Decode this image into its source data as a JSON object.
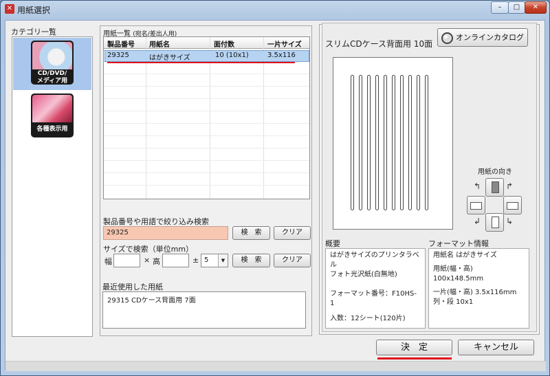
{
  "window": {
    "title": "用紙選択",
    "min": "–",
    "max": "□",
    "close": "✕",
    "accent": "#e0101a"
  },
  "category": {
    "label": "カテゴリ一覧",
    "items": [
      {
        "caption": "CD/DVD/\nメディア用",
        "selected": true
      },
      {
        "caption": "各種表示用",
        "selected": false
      }
    ]
  },
  "paper_list": {
    "title": "用紙一覧",
    "sub": "(宛名/差出人用)",
    "columns": [
      "製品番号",
      "用紙名",
      "面付数",
      "一片サイズ"
    ],
    "rows": [
      [
        "29325",
        "はがきサイズ",
        "10 (10x1)",
        "3.5x116"
      ]
    ]
  },
  "search": {
    "title": "製品番号や用語で絞り込み検索",
    "value": "29325",
    "search_label": "検　索",
    "clear_label": "クリア"
  },
  "size_search": {
    "title": "サイズで検索（単位mm）",
    "width_label": "幅",
    "times": "×",
    "height_label": "高",
    "plusminus": "±",
    "tolerance": "5",
    "search_label": "検　索",
    "clear_label": "クリア"
  },
  "recent": {
    "title": "最近使用した用紙",
    "items": [
      "29315 CDケース背面用 7面"
    ]
  },
  "preview": {
    "title": "スリムCDケース背面用 10面",
    "online_label": "オンラインカタログ",
    "slots": 10
  },
  "orientation": {
    "title": "用紙の向き"
  },
  "summary": {
    "title": "概要",
    "line1": "はがきサイズのプリンタラベル",
    "line2": "フォト光沢紙(白無地)",
    "format": "フォーマット番号：F10HS-1",
    "count": "入数：12シート(120片)"
  },
  "format_info": {
    "title": "フォーマット情報",
    "name": "用紙名  はがきサイズ",
    "paper": "用紙(幅・高) 100x148.5mm",
    "piece": "一片(幅・高) 3.5x116mm",
    "grid": "列・段  10x1"
  },
  "actions": {
    "ok": "決　定",
    "cancel": "キャンセル"
  }
}
